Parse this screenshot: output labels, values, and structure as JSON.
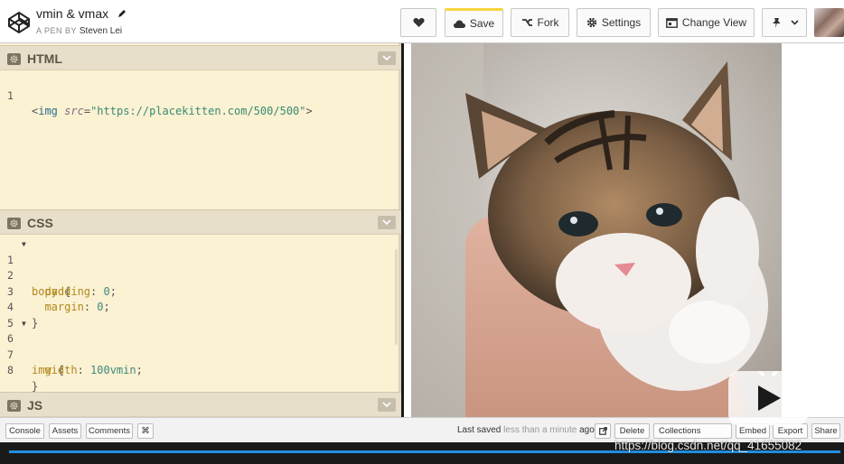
{
  "header": {
    "pen_title": "vmin & vmax",
    "byline_prefix": "A PEN BY",
    "author": "Steven Lei",
    "buttons": {
      "save": "Save",
      "fork": "Fork",
      "settings": "Settings",
      "change_view": "Change View"
    }
  },
  "editors": {
    "html": {
      "title": "HTML",
      "lines": [
        "1"
      ],
      "code": {
        "open": "<",
        "tag": "img",
        "attr": "src",
        "eq": "=",
        "value": "\"https://placekitten.com/500/500\"",
        "close": ">"
      }
    },
    "css": {
      "title": "CSS",
      "line_numbers": [
        "1",
        "2",
        "3",
        "4",
        "5",
        "6",
        "7",
        "8"
      ],
      "lines": [
        {
          "sel": "body",
          "rest": " {"
        },
        {
          "prop": "padding",
          "value": "0"
        },
        {
          "prop": "margin",
          "value": "0"
        },
        {
          "rest": "}"
        },
        {
          "rest": ""
        },
        {
          "sel": "img",
          "rest": " {"
        },
        {
          "prop": "width",
          "value": "100vmin"
        },
        {
          "rest": "}"
        }
      ]
    },
    "js": {
      "title": "JS"
    }
  },
  "footer": {
    "console": "Console",
    "assets": "Assets",
    "comments": "Comments",
    "shortcut": "⌘",
    "last_saved_label": "Last saved",
    "last_saved_time": "less than a minute",
    "last_saved_suffix": "ago",
    "delete": "Delete",
    "collections": "Collections",
    "embed": "Embed",
    "export": "Export",
    "share": "Share"
  },
  "watermark": "https://blog.csdn.net/qq_41655082",
  "colors": {
    "save_accent": "#f7d53d",
    "editor_bg": "#fbf1d3",
    "progress": "#1f8fe0"
  },
  "icons": [
    "codepen-logo-icon",
    "pencil-icon",
    "heart-icon",
    "cloud-icon",
    "fork-icon",
    "gear-icon",
    "layout-icon",
    "pin-icon",
    "chevron-down-icon",
    "external-link-icon",
    "play-icon"
  ]
}
